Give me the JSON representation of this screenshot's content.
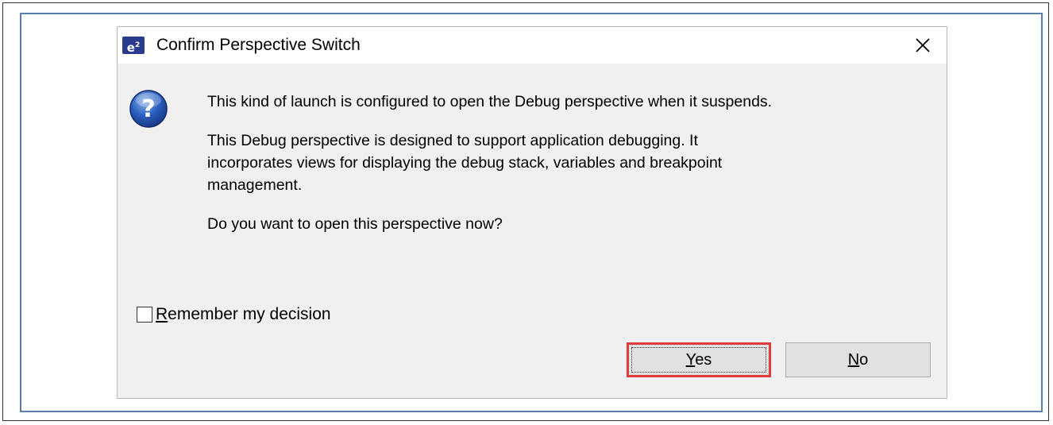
{
  "dialog": {
    "title": "Confirm Perspective Switch",
    "app_icon_text": "e",
    "app_icon_superscript": "2",
    "close_label": "✕",
    "message_lines_1": [
      "This kind of launch is configured to open the Debug perspective when it suspends."
    ],
    "message_lines_2": [
      "This Debug perspective is designed to support application debugging.  It",
      "incorporates views for displaying the debug stack, variables and breakpoint",
      "management."
    ],
    "question": "Do you want to open this perspective now?",
    "remember": {
      "label_mnemonic": "R",
      "label_rest": "emember my decision",
      "checked": false
    },
    "buttons": {
      "yes_mnemonic": "Y",
      "yes_rest": "es",
      "no_mnemonic": "N",
      "no_rest": "o"
    },
    "highlight_color": "#e0393e",
    "icons": {
      "app": "e2-studio-icon",
      "question": "question-icon",
      "close": "close-icon"
    }
  }
}
